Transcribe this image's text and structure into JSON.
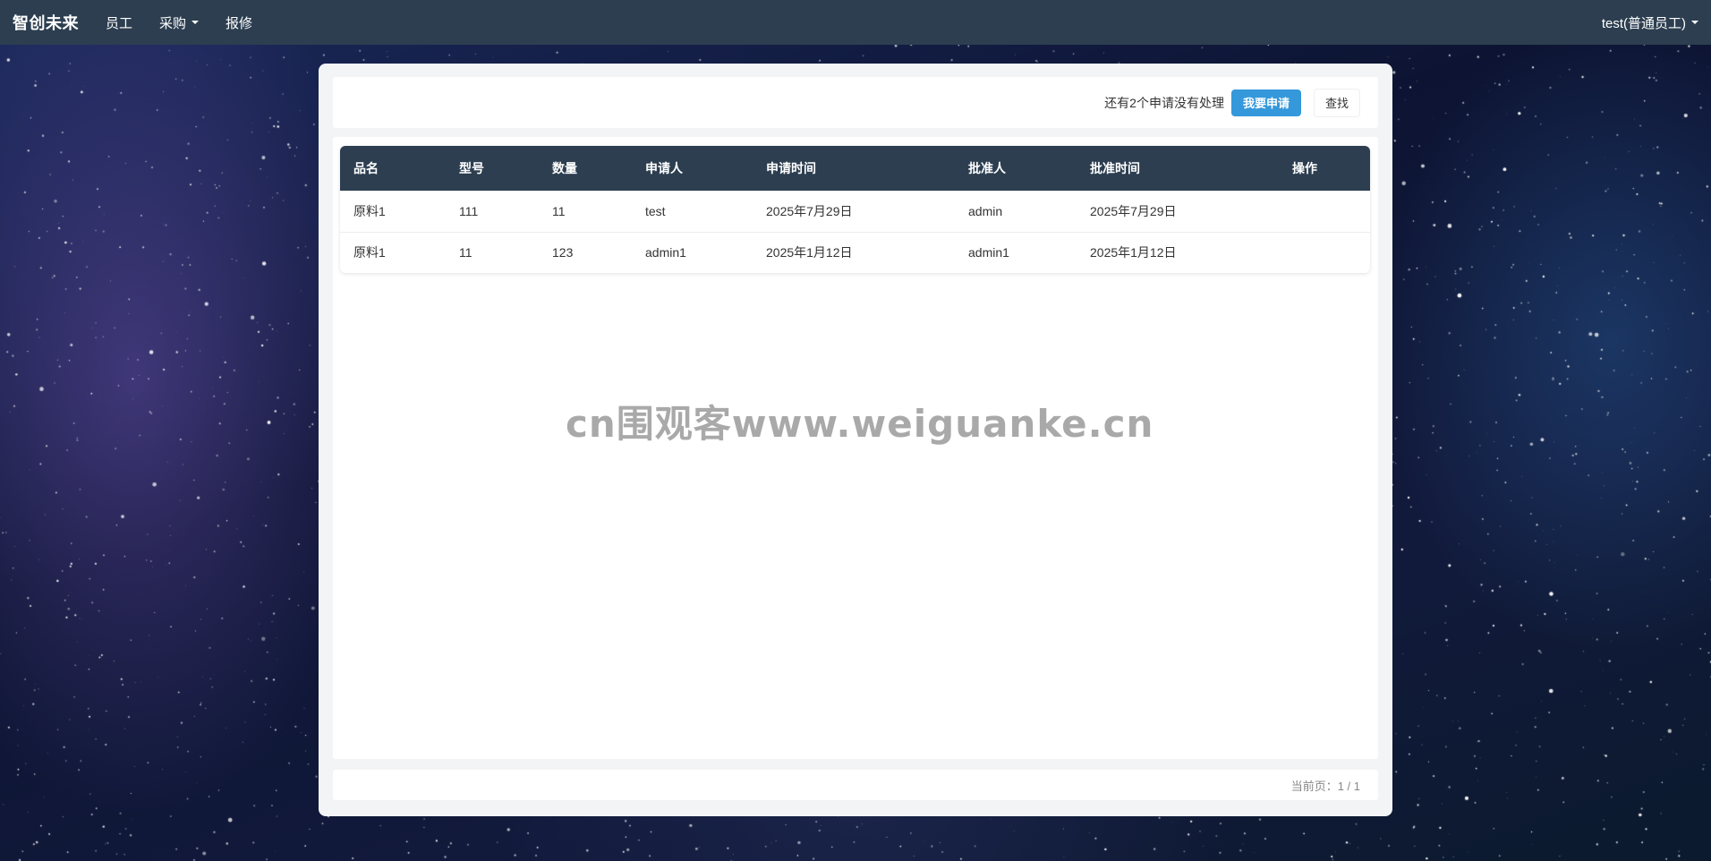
{
  "navbar": {
    "brand": "智创未来",
    "items": [
      {
        "label": "员工",
        "dropdown": false
      },
      {
        "label": "采购",
        "dropdown": true
      },
      {
        "label": "报修",
        "dropdown": false
      }
    ],
    "user": "test(普通员工)"
  },
  "toolbar": {
    "pending_text": "还有2个申请没有处理",
    "apply_label": "我要申请",
    "search_label": "查找"
  },
  "table": {
    "headers": [
      "品名",
      "型号",
      "数量",
      "申请人",
      "申请时间",
      "批准人",
      "批准时间",
      "操作"
    ],
    "rows": [
      [
        "原料1",
        "111",
        "11",
        "test",
        "2025年7月29日",
        "admin",
        "2025年7月29日",
        ""
      ],
      [
        "原料1",
        "11",
        "123",
        "admin1",
        "2025年1月12日",
        "admin1",
        "2025年1月12日",
        ""
      ]
    ]
  },
  "watermark": "cn围观客www.weiguanke.cn",
  "pagination": {
    "text": "当前页：1 / 1"
  },
  "colors": {
    "navbar": "#2c3e50",
    "table_header": "#2c3e50",
    "primary": "#3498db"
  }
}
